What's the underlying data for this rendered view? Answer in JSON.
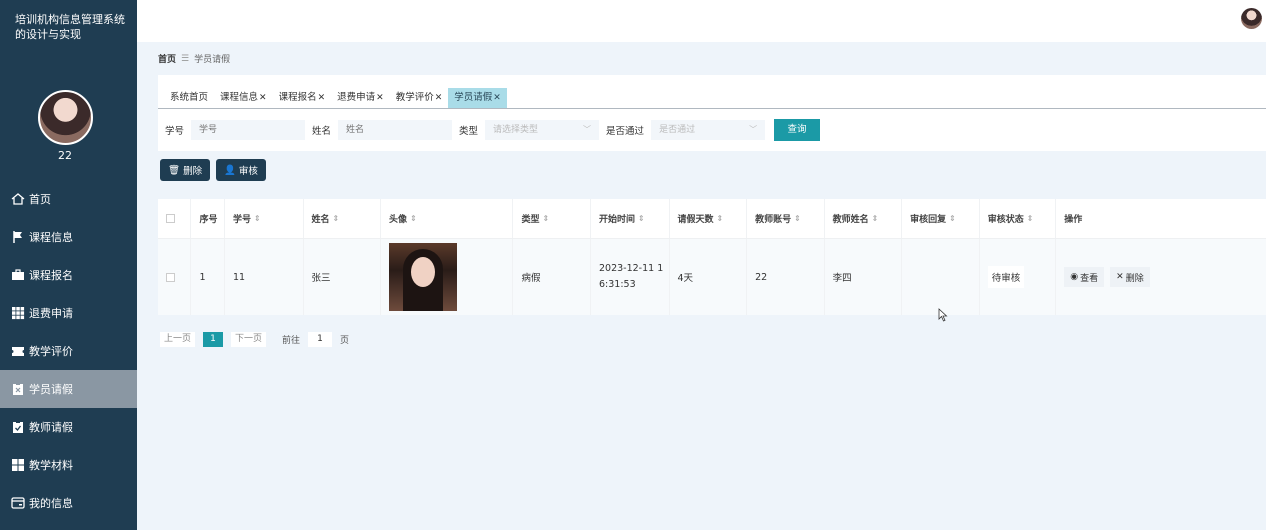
{
  "app": {
    "title": "培训机构信息管理系统的设计与实现",
    "user_id": "22"
  },
  "menu": [
    {
      "label": "首页",
      "icon": "home-icon",
      "active": false
    },
    {
      "label": "课程信息",
      "icon": "flag-icon",
      "active": false
    },
    {
      "label": "课程报名",
      "icon": "briefcase-icon",
      "active": false
    },
    {
      "label": "退费申请",
      "icon": "grid-icon",
      "active": false
    },
    {
      "label": "教学评价",
      "icon": "ticket-icon",
      "active": false
    },
    {
      "label": "学员请假",
      "icon": "clipboard-x-icon",
      "active": true
    },
    {
      "label": "教师请假",
      "icon": "clipboard-check-icon",
      "active": false
    },
    {
      "label": "教学材料",
      "icon": "apps-icon",
      "active": false
    },
    {
      "label": "我的信息",
      "icon": "wallet-icon",
      "active": false
    }
  ],
  "breadcrumb": {
    "home": "首页",
    "sep": "☰",
    "current": "学员请假"
  },
  "tabs": [
    {
      "label": "系统首页",
      "closable": false
    },
    {
      "label": "课程信息",
      "closable": true
    },
    {
      "label": "课程报名",
      "closable": true
    },
    {
      "label": "退费申请",
      "closable": true
    },
    {
      "label": "教学评价",
      "closable": true
    },
    {
      "label": "学员请假",
      "closable": true,
      "active": true
    }
  ],
  "filters": {
    "student_no_label": "学号",
    "student_no_placeholder": "学号",
    "name_label": "姓名",
    "name_placeholder": "姓名",
    "type_label": "类型",
    "type_placeholder": "请选择类型",
    "passed_label": "是否通过",
    "passed_placeholder": "是否通过",
    "search_label": "查询"
  },
  "actions": {
    "delete_label": "删除",
    "audit_label": "审核"
  },
  "table": {
    "headers": [
      "序号",
      "学号",
      "姓名",
      "头像",
      "类型",
      "开始时间",
      "请假天数",
      "教师账号",
      "教师姓名",
      "审核回复",
      "审核状态",
      "操作"
    ],
    "rows": [
      {
        "index": "1",
        "student_no": "11",
        "name": "张三",
        "type": "病假",
        "start_time_1": "2023-12-11 1",
        "start_time_2": "6:31:53",
        "days": "4天",
        "teacher_account": "22",
        "teacher_name": "李四",
        "reply": "",
        "status": "待审核",
        "view_label": "查看",
        "delete_label": "删除"
      }
    ]
  },
  "pager": {
    "prev": "上一页",
    "current": "1",
    "next": "下一页",
    "goto": "前往",
    "page_value": "1",
    "page_unit": "页"
  },
  "colors": {
    "sidebar": "#1f3d52",
    "accent": "#1b9aa6",
    "active_tab": "#a9dce8"
  }
}
